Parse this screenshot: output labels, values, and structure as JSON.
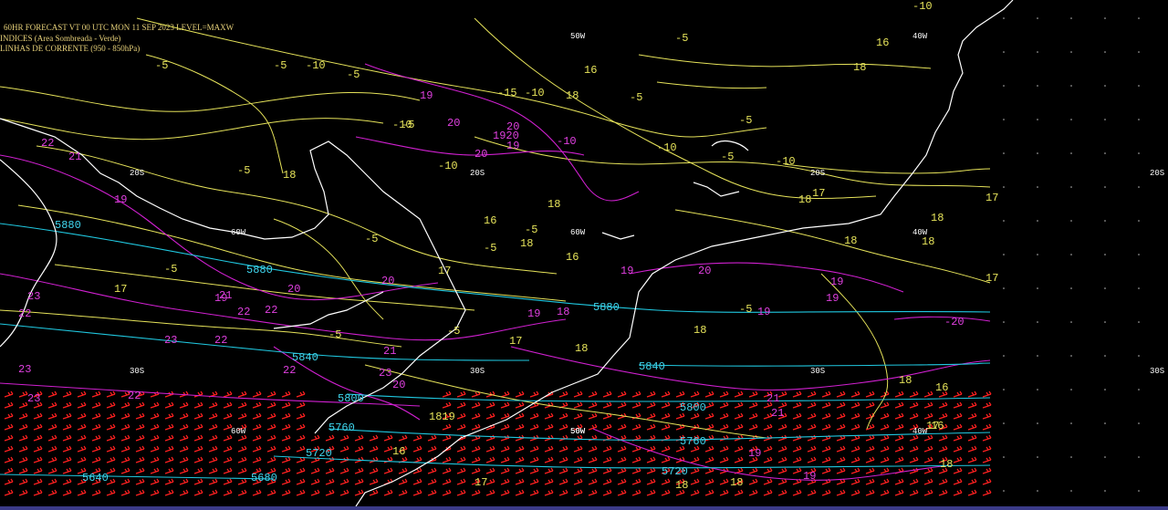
{
  "header": {
    "line1": "60HR FORECAST   VT 00 UTC MON 11 SEP 2023    LEVEL=MAXW",
    "line2": "INDICES (Area Sombreada - Verde)",
    "line3": "LINHAS DE CORRENTE (950 - 850hPa)"
  },
  "grid_labels": [
    {
      "text": "50W"
    },
    {
      "text": "40W"
    },
    {
      "text": "60W"
    },
    {
      "text": "60W"
    },
    {
      "text": "40W"
    },
    {
      "text": "50W"
    },
    {
      "text": "20S"
    },
    {
      "text": "20S"
    },
    {
      "text": "20S"
    },
    {
      "text": "20S"
    },
    {
      "text": "30S"
    },
    {
      "text": "30S"
    },
    {
      "text": "30S"
    },
    {
      "text": "30S"
    },
    {
      "text": "60W"
    },
    {
      "text": "50W"
    },
    {
      "text": "40W"
    }
  ],
  "yellow_labels": [
    "-5",
    "-10",
    "-5",
    "16",
    "-5",
    "-15",
    "-10",
    "-5",
    "18",
    "-10",
    "18",
    "-5",
    "-10",
    "-5",
    "-10",
    "16",
    "-5",
    "-5",
    "-5",
    "18",
    "16",
    "-5",
    "17",
    "17",
    "-5",
    "17",
    "18",
    "18",
    "18",
    "18",
    "-5",
    "18",
    "-5",
    "-10",
    "18",
    "17",
    "-5",
    "17",
    "18",
    "16",
    "17",
    "18",
    "17",
    "1819",
    "16",
    "16",
    "18",
    "18",
    "17",
    "18",
    "18",
    "-5",
    "16",
    "-5",
    "-10",
    "-5",
    "1161"
  ],
  "magenta_labels": [
    "19",
    "20",
    "20",
    "1920",
    "19",
    "20",
    "-10",
    "19",
    "21",
    "22",
    "19",
    "22",
    "21",
    "20",
    "22",
    "22",
    "21",
    "23",
    "22",
    "23",
    "22",
    "22",
    "23",
    "23",
    "21",
    "19",
    "19",
    "19",
    "19",
    "19",
    "-20",
    "21",
    "20",
    "20",
    "19",
    "18",
    "19",
    "20",
    "23"
  ],
  "cyan_labels": [
    "5880",
    "5880",
    "5880",
    "5840",
    "5840",
    "5800",
    "5800",
    "5760",
    "5760",
    "5720",
    "5720",
    "5680",
    "5640"
  ]
}
